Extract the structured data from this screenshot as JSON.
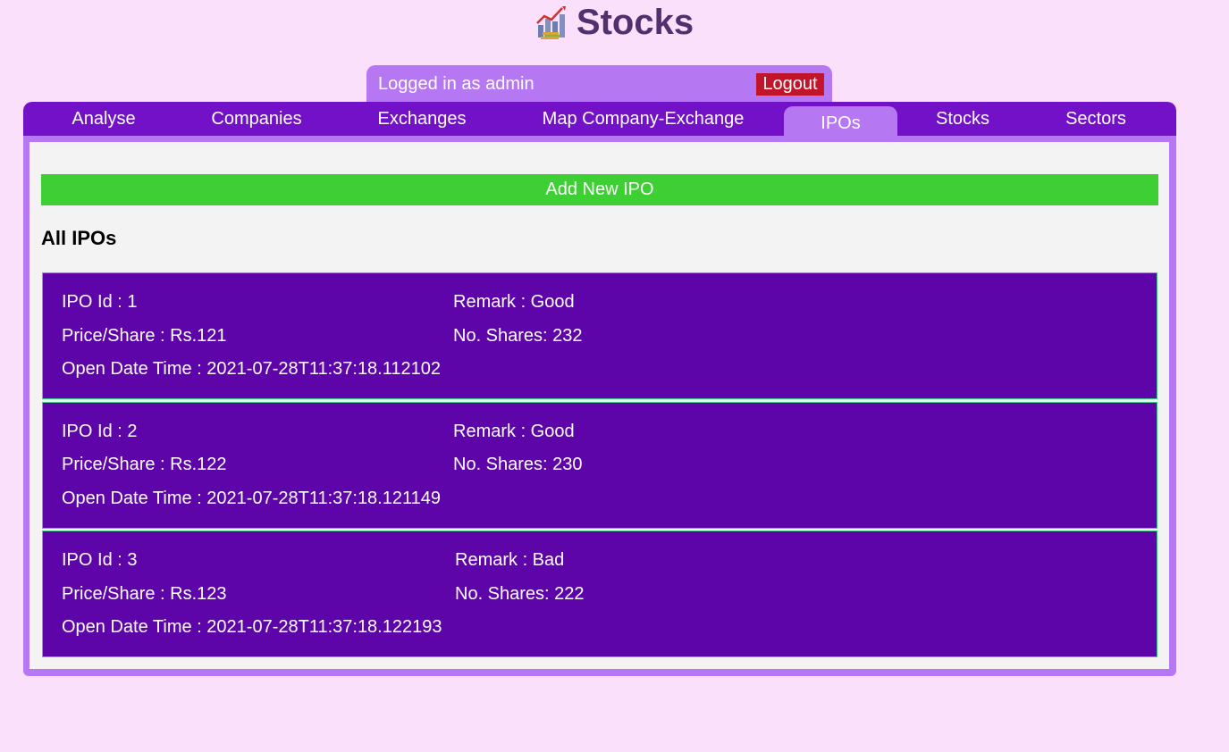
{
  "header": {
    "title": "Stocks",
    "logo_icon": "stocks-chart-icon"
  },
  "session": {
    "logged_in_text": "Logged in as admin",
    "logout_label": "Logout"
  },
  "nav": {
    "tabs": [
      {
        "label": "Analyse",
        "active": false
      },
      {
        "label": "Companies",
        "active": false
      },
      {
        "label": "Exchanges",
        "active": false
      },
      {
        "label": "Map Company-Exchange",
        "active": false
      },
      {
        "label": "IPOs",
        "active": true
      },
      {
        "label": "Stocks",
        "active": false
      },
      {
        "label": "Sectors",
        "active": false
      }
    ]
  },
  "main": {
    "add_button_label": "Add New IPO",
    "section_title": "All IPOs",
    "ipos": [
      {
        "id_text": "IPO Id : 1",
        "remark_text": "Remark : Good",
        "price_text": "Price/Share : Rs.121",
        "shares_text": "No. Shares: 232",
        "open_text": "Open Date Time : 2021-07-28T11:37:18.112102"
      },
      {
        "id_text": "IPO Id : 2",
        "remark_text": "Remark : Good",
        "price_text": "Price/Share : Rs.122",
        "shares_text": "No. Shares: 230",
        "open_text": "Open Date Time : 2021-07-28T11:37:18.121149"
      },
      {
        "id_text": "IPO Id : 3",
        "remark_text": "Remark : Bad",
        "price_text": "Price/Share : Rs.123",
        "shares_text": "No. Shares: 222",
        "open_text": "Open Date Time : 2021-07-28T11:37:18.122193"
      }
    ]
  },
  "colors": {
    "page_bg": "#fbe0fc",
    "title": "#532f70",
    "nav_bg": "#7311c9",
    "accent": "#b678f2",
    "logout": "#c0152a",
    "add_button": "#3ecf34",
    "card_bg": "#5e05aa"
  }
}
